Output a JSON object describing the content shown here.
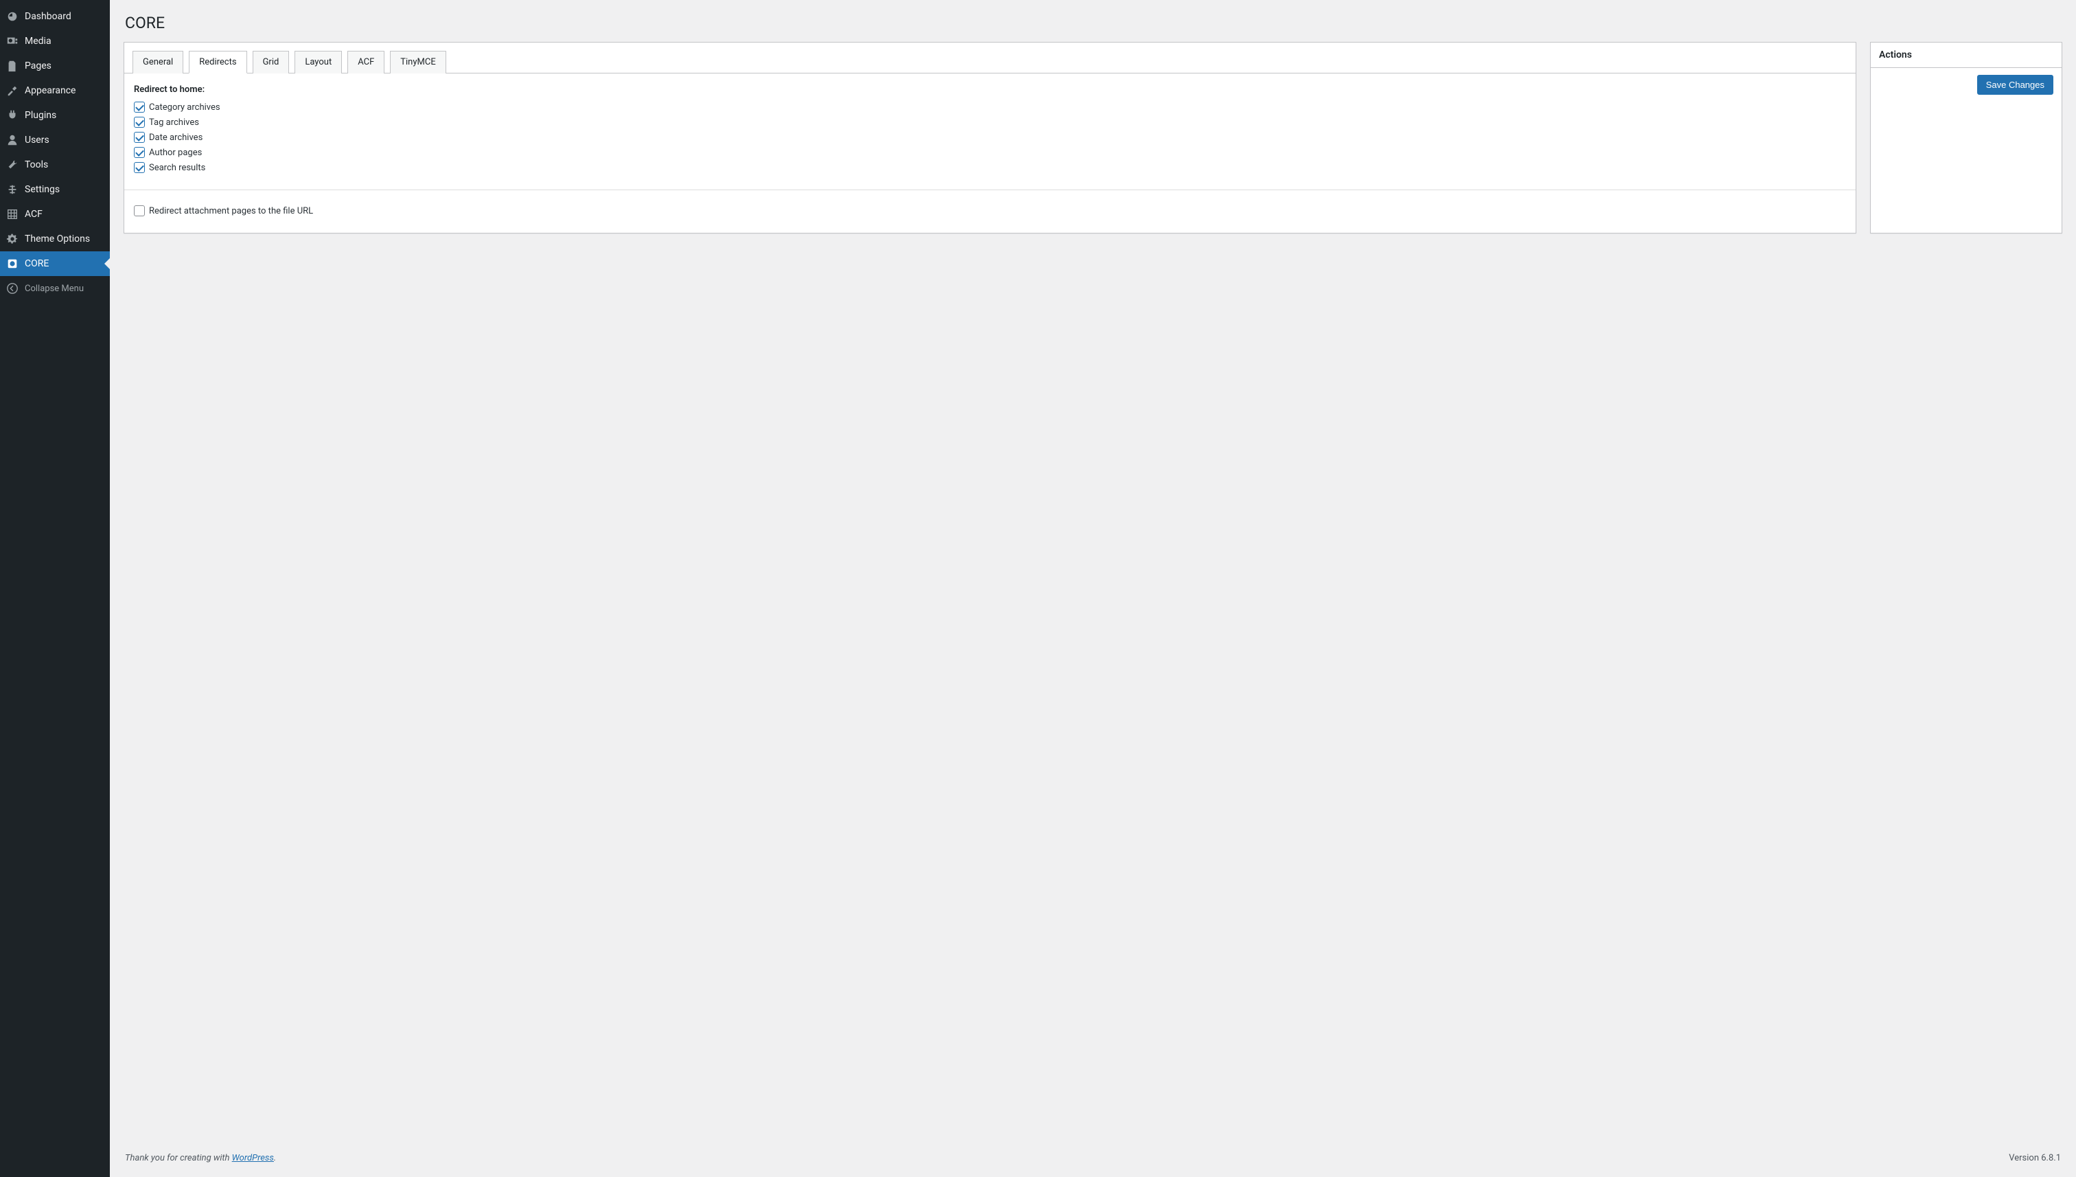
{
  "sidebar": {
    "items": [
      {
        "id": "dashboard",
        "label": "Dashboard"
      },
      {
        "id": "media",
        "label": "Media"
      },
      {
        "id": "pages",
        "label": "Pages"
      },
      {
        "id": "appearance",
        "label": "Appearance"
      },
      {
        "id": "plugins",
        "label": "Plugins"
      },
      {
        "id": "users",
        "label": "Users"
      },
      {
        "id": "tools",
        "label": "Tools"
      },
      {
        "id": "settings",
        "label": "Settings"
      },
      {
        "id": "acf",
        "label": "ACF"
      },
      {
        "id": "theme-options",
        "label": "Theme Options"
      },
      {
        "id": "core",
        "label": "CORE"
      }
    ],
    "collapse_label": "Collapse Menu"
  },
  "page": {
    "title": "CORE"
  },
  "tabs": [
    {
      "id": "general",
      "label": "General"
    },
    {
      "id": "redirects",
      "label": "Redirects"
    },
    {
      "id": "grid",
      "label": "Grid"
    },
    {
      "id": "layout",
      "label": "Layout"
    },
    {
      "id": "acf",
      "label": "ACF"
    },
    {
      "id": "tinymce",
      "label": "TinyMCE"
    }
  ],
  "redirects": {
    "heading": "Redirect to home:",
    "options": [
      {
        "id": "category",
        "label": "Category archives",
        "checked": true
      },
      {
        "id": "tag",
        "label": "Tag archives",
        "checked": true
      },
      {
        "id": "date",
        "label": "Date archives",
        "checked": true
      },
      {
        "id": "author",
        "label": "Author pages",
        "checked": true
      },
      {
        "id": "search",
        "label": "Search results",
        "checked": true
      }
    ],
    "attachment": {
      "label": "Redirect attachment pages to the file URL",
      "checked": false
    }
  },
  "actions": {
    "heading": "Actions",
    "save_label": "Save Changes"
  },
  "footer": {
    "prefix": "Thank you for creating with ",
    "link": "WordPress",
    "suffix": ".",
    "version": "Version 6.8.1"
  }
}
